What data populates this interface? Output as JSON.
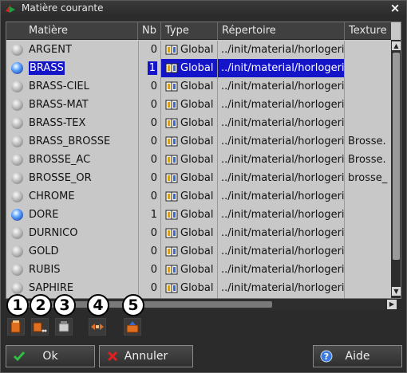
{
  "window": {
    "title": "Matière courante",
    "close_glyph": "×"
  },
  "columns": {
    "name": "Matière",
    "nb": "Nb",
    "type": "Type",
    "dir": "Répertoire",
    "texture": "Texture"
  },
  "rows": [
    {
      "name": "ARGENT",
      "nb": "0",
      "type": "Global",
      "dir": "../init/material/horlogerie",
      "texture": "",
      "icon": "gray",
      "selected": false
    },
    {
      "name": "BRASS",
      "nb": "1",
      "type": "Global",
      "dir": "../init/material/horlogerie",
      "texture": "",
      "icon": "blue",
      "selected": true
    },
    {
      "name": "BRASS-CIEL",
      "nb": "0",
      "type": "Global",
      "dir": "../init/material/horlogerie",
      "texture": "",
      "icon": "gray",
      "selected": false
    },
    {
      "name": "BRASS-MAT",
      "nb": "0",
      "type": "Global",
      "dir": "../init/material/horlogerie",
      "texture": "",
      "icon": "gray",
      "selected": false
    },
    {
      "name": "BRASS-TEX",
      "nb": "0",
      "type": "Global",
      "dir": "../init/material/horlogerie",
      "texture": "",
      "icon": "gray",
      "selected": false
    },
    {
      "name": "BRASS_BROSSE",
      "nb": "0",
      "type": "Global",
      "dir": "../init/material/horlogerie",
      "texture": "Brosse.",
      "icon": "gray",
      "selected": false
    },
    {
      "name": "BROSSE_AC",
      "nb": "0",
      "type": "Global",
      "dir": "../init/material/horlogerie",
      "texture": "Brosse.",
      "icon": "gray",
      "selected": false
    },
    {
      "name": "BROSSE_OR",
      "nb": "0",
      "type": "Global",
      "dir": "../init/material/horlogerie",
      "texture": "brosse_",
      "icon": "gray",
      "selected": false
    },
    {
      "name": "CHROME",
      "nb": "0",
      "type": "Global",
      "dir": "../init/material/horlogerie",
      "texture": "",
      "icon": "gray",
      "selected": false
    },
    {
      "name": "DORE",
      "nb": "1",
      "type": "Global",
      "dir": "../init/material/horlogerie",
      "texture": "",
      "icon": "blue",
      "selected": false
    },
    {
      "name": "DURNICO",
      "nb": "0",
      "type": "Global",
      "dir": "../init/material/horlogerie",
      "texture": "",
      "icon": "gray",
      "selected": false
    },
    {
      "name": "GOLD",
      "nb": "0",
      "type": "Global",
      "dir": "../init/material/horlogerie",
      "texture": "",
      "icon": "gray",
      "selected": false
    },
    {
      "name": "RUBIS",
      "nb": "0",
      "type": "Global",
      "dir": "../init/material/horlogerie",
      "texture": "",
      "icon": "gray",
      "selected": false
    },
    {
      "name": "SAPHIRE",
      "nb": "0",
      "type": "Global",
      "dir": "../init/material/horlogerie",
      "texture": "",
      "icon": "gray",
      "selected": false
    }
  ],
  "toolbar": {
    "icons": [
      "new-material-icon",
      "duplicate-material-icon",
      "import-material-icon",
      "replace-material-icon",
      "edit-material-icon"
    ],
    "badges": [
      "1",
      "2",
      "3",
      "4",
      "5"
    ]
  },
  "buttons": {
    "ok": "Ok",
    "cancel": "Annuler",
    "help": "Aide"
  },
  "colors": {
    "selection": "#1414c8",
    "grid_bg": "#c8c8c8",
    "header_bg": "#404040",
    "window_bg": "#2b2b2b"
  }
}
